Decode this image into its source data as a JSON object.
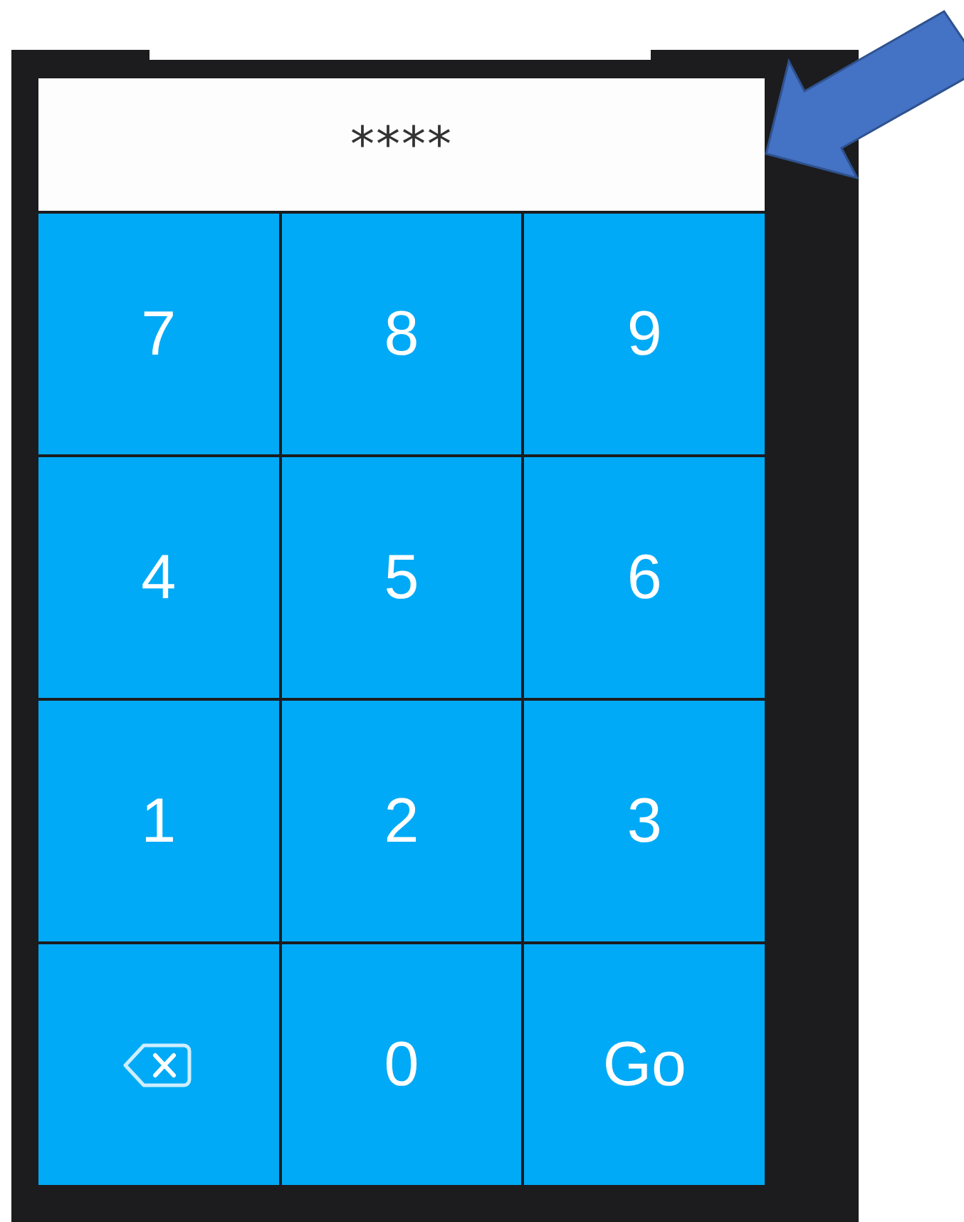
{
  "passcode_field": {
    "value": "****"
  },
  "keys": [
    {
      "kind": "digit",
      "label": "7"
    },
    {
      "kind": "digit",
      "label": "8"
    },
    {
      "kind": "digit",
      "label": "9"
    },
    {
      "kind": "digit",
      "label": "4"
    },
    {
      "kind": "digit",
      "label": "5"
    },
    {
      "kind": "digit",
      "label": "6"
    },
    {
      "kind": "digit",
      "label": "1"
    },
    {
      "kind": "digit",
      "label": "2"
    },
    {
      "kind": "digit",
      "label": "3"
    },
    {
      "kind": "backspace"
    },
    {
      "kind": "digit",
      "label": "0"
    },
    {
      "kind": "action",
      "label": "Go"
    }
  ]
}
